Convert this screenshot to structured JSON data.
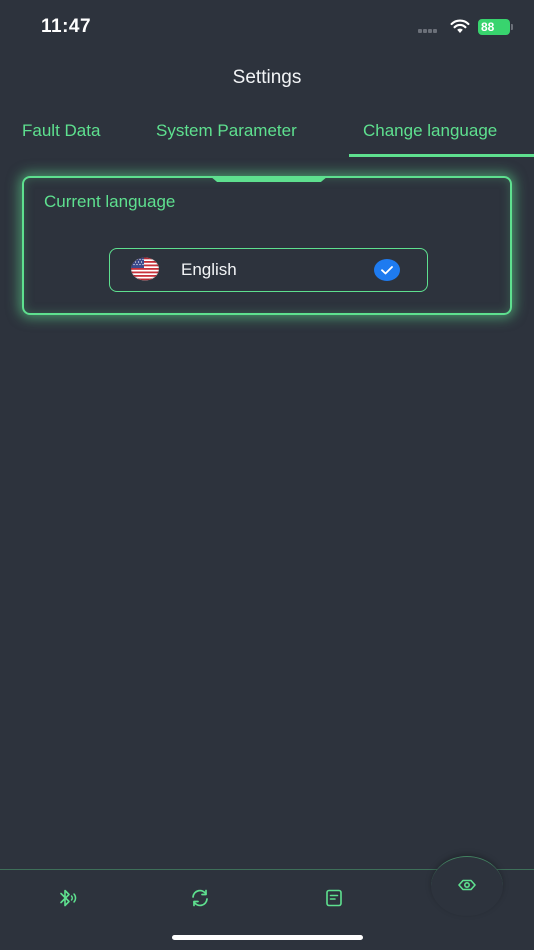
{
  "status_bar": {
    "time": "11:47",
    "battery": "88"
  },
  "header": {
    "title": "Settings"
  },
  "tabs": [
    {
      "label": "Fault Data",
      "active": false
    },
    {
      "label": "System Parameter",
      "active": false
    },
    {
      "label": "Change language",
      "active": true
    }
  ],
  "language_card": {
    "label": "Current language",
    "selected_language": "English",
    "flag_icon": "us-flag-icon",
    "check_icon": "check-circle-icon"
  },
  "bottom_nav": {
    "items": [
      {
        "icon": "bluetooth-icon"
      },
      {
        "icon": "sync-icon"
      },
      {
        "icon": "log-icon"
      },
      {
        "icon": "settings-eye-icon",
        "active": true
      }
    ]
  },
  "colors": {
    "background": "#2d333d",
    "accent": "#5ee08f",
    "check_blue": "#1e7bf0",
    "battery": "#38d46e"
  }
}
